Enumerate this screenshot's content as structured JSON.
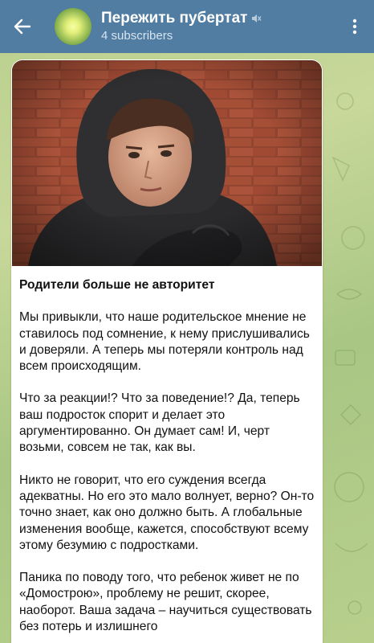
{
  "header": {
    "title": "Пережить пубертат",
    "subtitle": "4 subscribers",
    "back_icon": "arrow-left-icon",
    "mute_icon": "speaker-muted-icon",
    "menu_icon": "more-vertical-icon"
  },
  "post": {
    "image_icon": "photo-teen-in-hoodie",
    "title": "Родители больше не авторитет",
    "paragraphs": [
      "Мы привыкли, что наше родительское мнение не ставилось под сомнение, к нему прислушивались и доверяли. А теперь мы потеряли контроль над всем происходящим.",
      "Что за реакции!? Что за поведение!? Да, теперь ваш подросток спорит и делает это аргументированно. Он думает сам!  И, черт возьми, совсем не так, как вы.",
      "Никто не говорит, что его суждения всегда адекватны. Но его это мало волнует, верно? Он-то точно знает, как оно должно быть. А глобальные изменения вообще, кажется, способствуют всему этому безумию с подростками.",
      "Паника по поводу того, что ребенок живет не по «Домострою», проблему не решит, скорее, наоборот. Ваша задача – научиться существовать без потерь и излишнего"
    ]
  },
  "colors": {
    "header_bg": "#517da2",
    "wallpaper": "#b9cf8e",
    "bubble_bg": "#ffffff"
  }
}
